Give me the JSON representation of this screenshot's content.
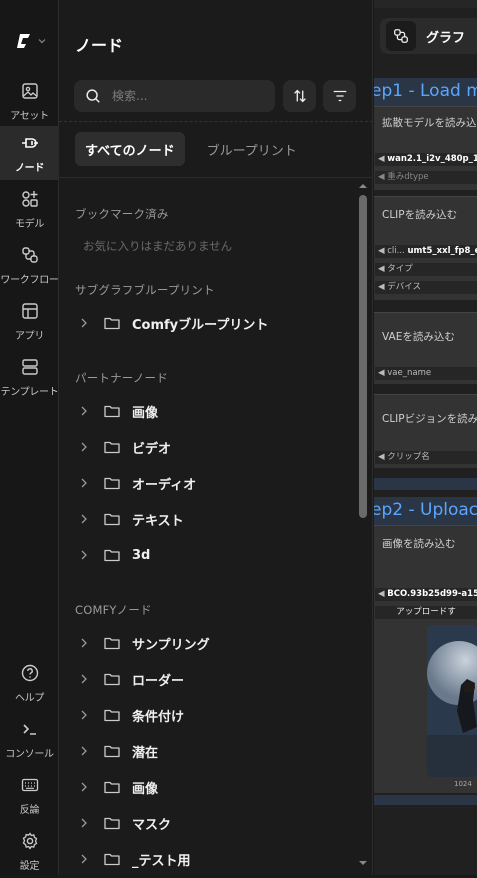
{
  "rail": {
    "logo_icon": "comfy-logo-icon",
    "items": [
      {
        "label": "アセット",
        "icon": "image-icon"
      },
      {
        "label": "ノード",
        "icon": "plug-icon"
      },
      {
        "label": "モデル",
        "icon": "shapes-icon"
      },
      {
        "label": "ワークフロー",
        "icon": "workflow-icon"
      },
      {
        "label": "アプリ",
        "icon": "layout-icon"
      },
      {
        "label": "テンプレート",
        "icon": "template-icon"
      }
    ],
    "bottom": [
      {
        "label": "ヘルプ",
        "icon": "help-icon"
      },
      {
        "label": "コンソール",
        "icon": "terminal-icon"
      },
      {
        "label": "反論",
        "icon": "keyboard-icon"
      },
      {
        "label": "設定",
        "icon": "gear-icon"
      }
    ]
  },
  "panel": {
    "title": "ノード",
    "search_placeholder": "検索...",
    "tabs": [
      "すべてのノード",
      "ブループリント"
    ],
    "bookmarks": {
      "title": "ブックマーク済み",
      "empty": "お気に入りはまだありません"
    },
    "subgraph": {
      "title": "サブグラフブループリント",
      "folders": [
        "Comfyブループリント"
      ]
    },
    "partner": {
      "title": "パートナーノード",
      "folders": [
        "画像",
        "ビデオ",
        "オーディオ",
        "テキスト",
        "3d"
      ]
    },
    "comfy": {
      "title": "COMFYノード",
      "folders": [
        "サンプリング",
        "ローダー",
        "条件付け",
        "潜在",
        "画像",
        "マスク",
        "_テスト用"
      ]
    }
  },
  "graph": {
    "tab_title": "グラフ",
    "group1": "ep1 - Load m",
    "group2": "ep2 - Uploac",
    "nodes": {
      "diffusion": {
        "title": "拡散モデルを読み込",
        "w1_value": "wan2.1_i2v_480p_14B",
        "w2": "重みdtype"
      },
      "clip": {
        "title": "CLIPを読み込む",
        "w1_label": "cli...",
        "w1_value": "umt5_xxl_fp8_e4",
        "w2": "タイプ",
        "w3": "デバイス"
      },
      "vae": {
        "title": "VAEを読み込む",
        "w1": "vae_name"
      },
      "clipvision": {
        "title": "CLIPビジョンを読み",
        "w1": "クリップ名"
      },
      "loadimage": {
        "title": "画像を読み込む",
        "w1": "BCO.93b25d99-a150",
        "upload": "アップロードす",
        "size": "1024"
      }
    }
  },
  "colors": {
    "accent": "#5aa6ff",
    "active_bg": "#2e2e2e",
    "panel_bg": "#1b1b1b"
  }
}
